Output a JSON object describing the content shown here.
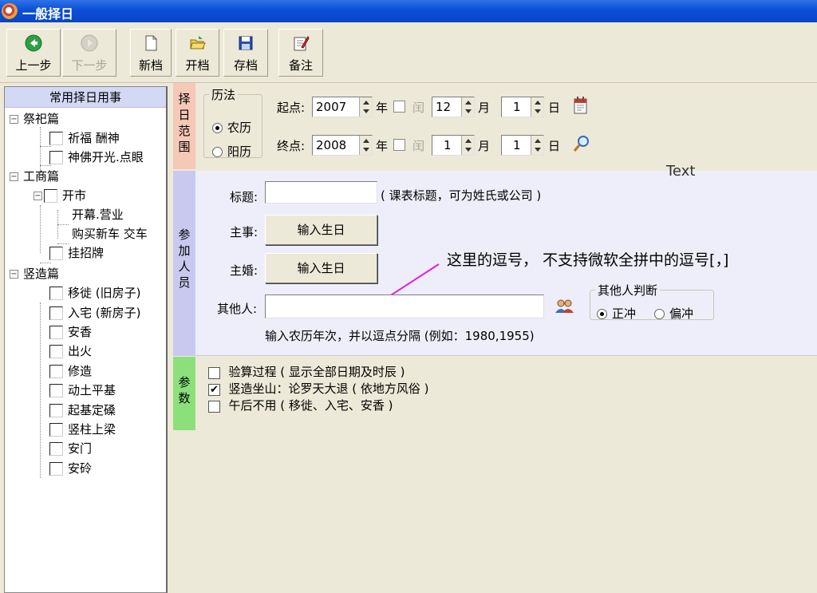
{
  "window": {
    "title": "一般择日"
  },
  "toolbar": {
    "buttons": [
      {
        "label": "上一步",
        "icon": "back-arrow-icon"
      },
      {
        "label": "下一步",
        "icon": "forward-arrow-icon"
      },
      {
        "label": "新档",
        "icon": "new-document-icon"
      },
      {
        "label": "开档",
        "icon": "open-folder-icon"
      },
      {
        "label": "存档",
        "icon": "save-disk-icon"
      },
      {
        "label": "备注",
        "icon": "notes-icon"
      }
    ]
  },
  "sidebar": {
    "header": "常用择日用事",
    "tree": [
      {
        "label": "祭祀篇",
        "level": 0,
        "expanded": true
      },
      {
        "label": "祈福 酬神",
        "level": 1
      },
      {
        "label": "神佛开光.点眼",
        "level": 1
      },
      {
        "label": "工商篇",
        "level": 0,
        "expanded": true
      },
      {
        "label": "开市",
        "level": 1,
        "expanded": true
      },
      {
        "label": "开幕.营业",
        "level": 2
      },
      {
        "label": "购买新车 交车",
        "level": 2
      },
      {
        "label": "挂招牌",
        "level": 1
      },
      {
        "label": "竖造篇",
        "level": 0,
        "expanded": true
      },
      {
        "label": "移徙 (旧房子)",
        "level": 1
      },
      {
        "label": "入宅 (新房子)",
        "level": 1
      },
      {
        "label": "安香",
        "level": 1
      },
      {
        "label": "出火",
        "level": 1
      },
      {
        "label": "修造",
        "level": 1
      },
      {
        "label": "动土平基",
        "level": 1
      },
      {
        "label": "起基定磉",
        "level": 1
      },
      {
        "label": "竖柱上梁",
        "level": 1
      },
      {
        "label": "安门",
        "level": 1
      },
      {
        "label": "安砱",
        "level": 1
      }
    ]
  },
  "date_range": {
    "section_label": "择日范围",
    "calendar_group": {
      "title": "历法",
      "options": [
        "农历",
        "阳历"
      ],
      "selected": "农历"
    },
    "start": {
      "label": "起点:",
      "year": "2007",
      "year_unit": "年",
      "leap_label": "闰",
      "month": "12",
      "month_unit": "月",
      "day": "1",
      "day_unit": "日",
      "icon": "calendar-icon"
    },
    "end": {
      "label": "终点:",
      "year": "2008",
      "year_unit": "年",
      "leap_label": "闰",
      "month": "1",
      "month_unit": "月",
      "day": "1",
      "day_unit": "日",
      "icon": "magnifier-icon"
    }
  },
  "participants": {
    "section_label": "参加人员",
    "annotation_text": "Text",
    "title_label": "标题:",
    "title_value": "",
    "title_hint": "( 课表标题，可为姓氏或公司 )",
    "host_label": "主事:",
    "host_button": "输入生日",
    "wedding_label": "主婚:",
    "wedding_button": "输入生日",
    "others_label": "其他人:",
    "others_value": "",
    "others_hint": "输入农历年次，并以逗点分隔 (例如：1980,1955)",
    "others_icon": "people-icon",
    "judge_group": {
      "title": "其他人判断",
      "options": [
        "正冲",
        "偏冲"
      ],
      "selected": "正冲"
    },
    "callout_text": "这里的逗号， 不支持微软全拼中的逗号[，]",
    "callout_color": "#E020E0"
  },
  "params": {
    "section_label": "参数",
    "options": [
      {
        "label": "验算过程 ( 显示全部日期及时辰 )",
        "checked": false
      },
      {
        "label": "竖造坐山：论罗天大退 ( 依地方风俗 )",
        "checked": true
      },
      {
        "label": "午后不用 ( 移徙、入宅、安香 )",
        "checked": false
      }
    ]
  },
  "colors": {
    "title_bar": "#0A4FD6",
    "date_tab": "#F6C8B8",
    "people_tab": "#C9C9F0",
    "param_tab": "#8CE07C",
    "sidebar_header": "#D3D8F4"
  }
}
